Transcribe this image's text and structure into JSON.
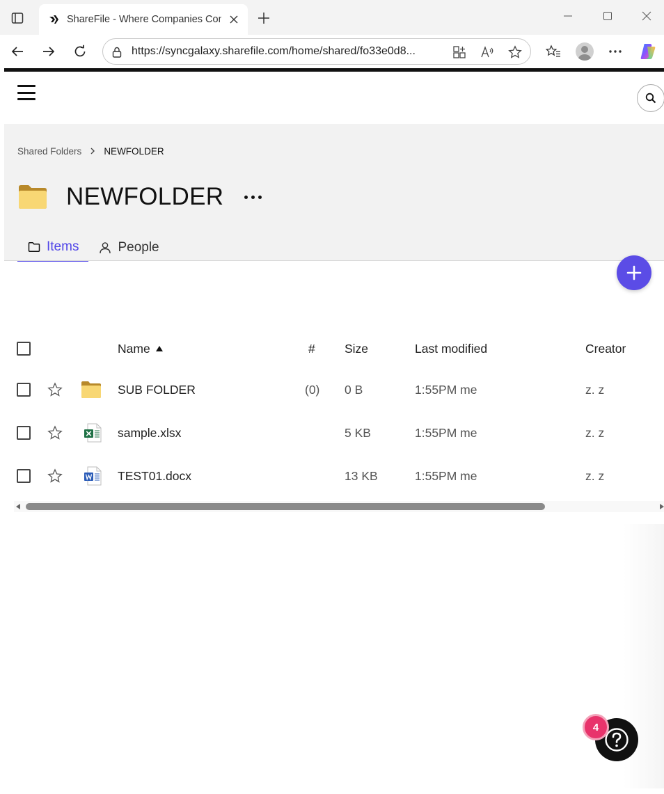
{
  "browser": {
    "tab_title": "ShareFile - Where Companies Connect",
    "url": "https://syncgalaxy.sharefile.com/home/shared/fo33e0d8..."
  },
  "breadcrumb": {
    "parent": "Shared Folders",
    "current": "NEWFOLDER"
  },
  "folder": {
    "title": "NEWFOLDER"
  },
  "tabs": [
    {
      "label": "Items",
      "active": true
    },
    {
      "label": "People",
      "active": false
    }
  ],
  "table": {
    "columns": {
      "name": "Name",
      "count": "#",
      "size": "Size",
      "modified": "Last modified",
      "creator": "Creator"
    },
    "rows": [
      {
        "name": "SUB FOLDER",
        "type": "folder",
        "count": "(0)",
        "size": "0 B",
        "modified": "1:55PM me",
        "creator": "z. z"
      },
      {
        "name": "sample.xlsx",
        "type": "excel",
        "count": "",
        "size": "5 KB",
        "modified": "1:55PM me",
        "creator": "z. z"
      },
      {
        "name": "TEST01.docx",
        "type": "word",
        "count": "",
        "size": "13 KB",
        "modified": "1:55PM me",
        "creator": "z. z"
      }
    ]
  },
  "help": {
    "badge_count": "4"
  },
  "colors": {
    "accent": "#5146e8",
    "fab": "#5b4ce6",
    "badge": "#e8336b",
    "folder": "#f3cc62"
  }
}
